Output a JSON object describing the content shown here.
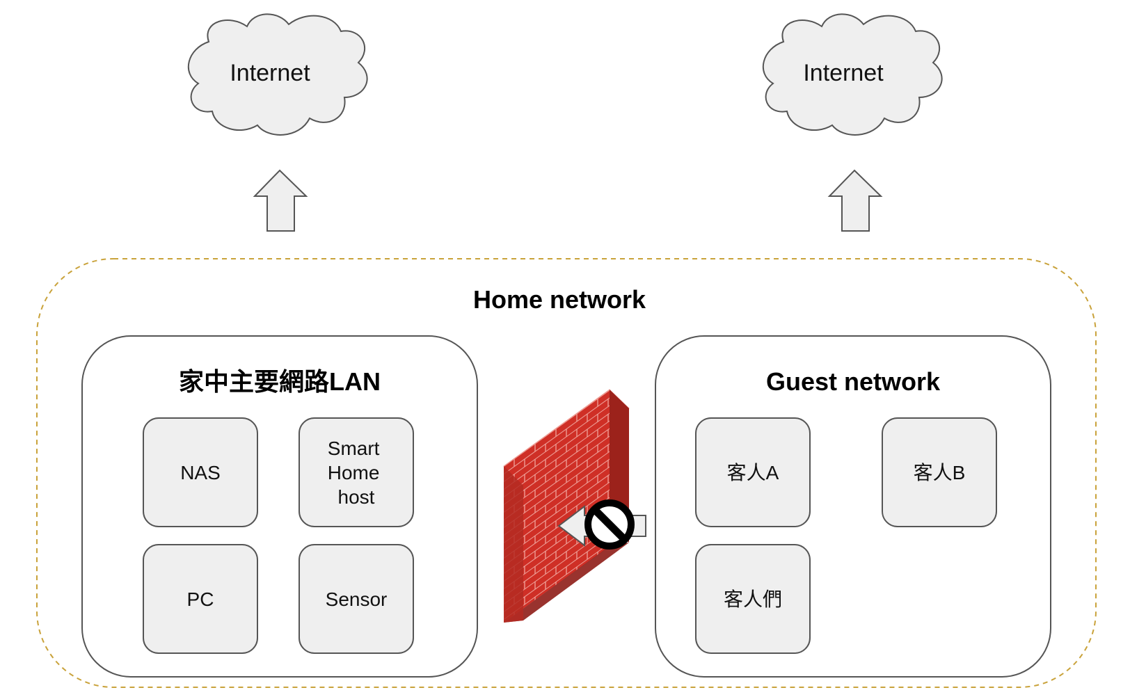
{
  "clouds": [
    {
      "label": "Internet"
    },
    {
      "label": "Internet"
    }
  ],
  "home_network": {
    "title": "Home network"
  },
  "main_lan": {
    "title": "家中主要網路LAN",
    "devices": [
      "NAS",
      "Smart Home host",
      "PC",
      "Sensor"
    ]
  },
  "guest_network": {
    "title": "Guest network",
    "devices": [
      "客人A",
      "客人B",
      "客人們"
    ]
  },
  "firewall": {
    "icon": "brick-firewall-icon",
    "blocked_icon": "no-entry-icon"
  },
  "colors": {
    "cloud_fill": "#efefef",
    "box_fill": "#efefef",
    "outline": "#555555",
    "dashed_border": "#c9a23a",
    "brick_red": "#d8352a",
    "brick_dark": "#a3251d"
  }
}
